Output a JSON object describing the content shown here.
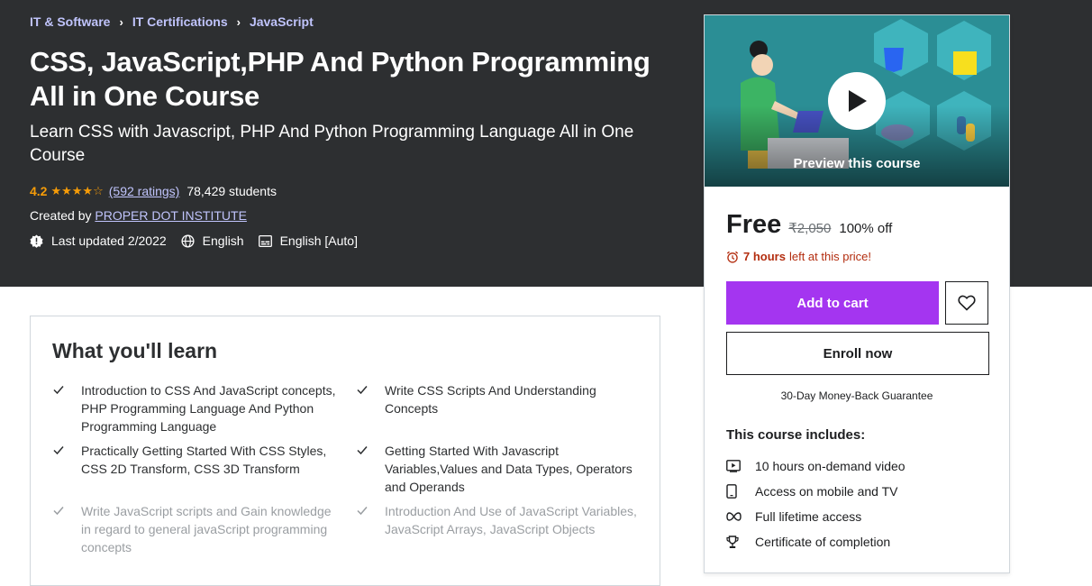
{
  "breadcrumb": [
    "IT & Software",
    "IT Certifications",
    "JavaScript"
  ],
  "course": {
    "title": "CSS, JavaScript,PHP And Python Programming All in One Course",
    "subtitle": "Learn CSS with Javascript, PHP And Python Programming Language All in One Course",
    "rating": "4.2",
    "rating_value": 4.2,
    "ratings_count": "(592 ratings)",
    "students": "78,429 students",
    "created_by_label": "Created by",
    "instructor": "PROPER DOT INSTITUTE",
    "last_updated": "Last updated 2/2022",
    "language": "English",
    "captions": "English [Auto]"
  },
  "sidebar": {
    "preview_label": "Preview this course",
    "preview_badges": [
      "CSS",
      "JS",
      "php"
    ],
    "price": "Free",
    "original_price": "₹2,050",
    "discount": "100% off",
    "timer_hours": "7 hours",
    "timer_text": "left at this price!",
    "add_to_cart": "Add to cart",
    "enroll_now": "Enroll now",
    "guarantee": "30-Day Money-Back Guarantee",
    "includes_title": "This course includes:",
    "includes": [
      {
        "icon": "video-icon",
        "text": "10 hours on-demand video"
      },
      {
        "icon": "mobile-icon",
        "text": "Access on mobile and TV"
      },
      {
        "icon": "infinity-icon",
        "text": "Full lifetime access"
      },
      {
        "icon": "trophy-icon",
        "text": "Certificate of completion"
      }
    ]
  },
  "learn": {
    "title": "What you'll learn",
    "items": [
      "Introduction to CSS And JavaScript concepts, PHP Programming Language And Python Programming Language",
      "Write CSS Scripts And Understanding Concepts",
      "Practically Getting Started With CSS Styles, CSS 2D Transform, CSS 3D Transform",
      "Getting Started With Javascript Variables,Values and Data Types, Operators and Operands",
      "Write JavaScript scripts and Gain knowledge in regard to general javaScript programming concepts",
      "Introduction And Use of JavaScript Variables, JavaScript Arrays, JavaScript Objects"
    ]
  },
  "colors": {
    "hero_bg": "#2d2f31",
    "link_purple": "#c0c4fc",
    "star_orange": "#f69c08",
    "cta_purple": "#a435f0",
    "timer_red": "#b32d0f",
    "preview_teal": "#2b8e95"
  }
}
